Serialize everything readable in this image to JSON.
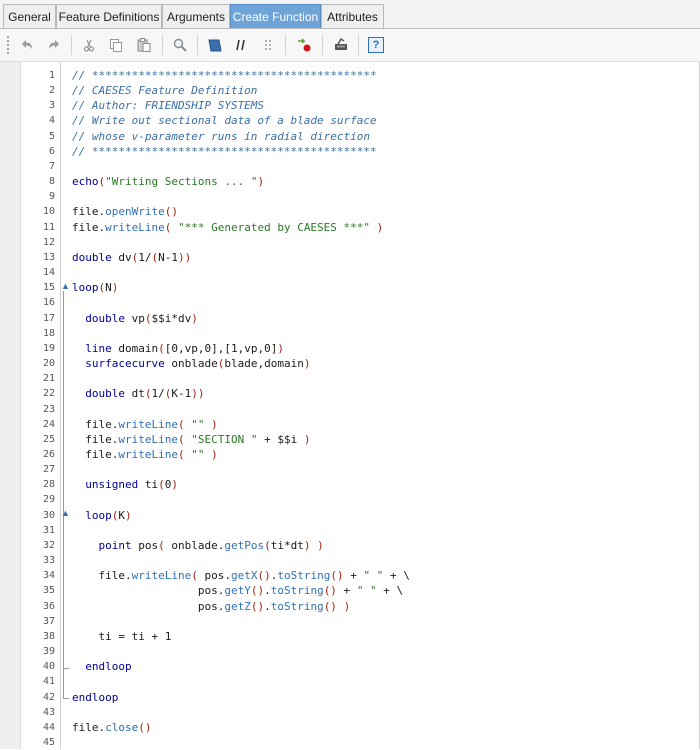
{
  "tabs": [
    {
      "label": "General",
      "active": false
    },
    {
      "label": "Feature Definitions",
      "active": false
    },
    {
      "label": "Arguments",
      "active": false
    },
    {
      "label": "Create Function",
      "active": true
    },
    {
      "label": "Attributes",
      "active": false
    }
  ],
  "toolbar": {
    "buttons": [
      {
        "name": "undo-icon"
      },
      {
        "name": "redo-icon"
      },
      {
        "name": "cut-icon"
      },
      {
        "name": "copy-icon"
      },
      {
        "name": "paste-icon"
      },
      {
        "name": "find-icon"
      },
      {
        "name": "bookmark-icon"
      },
      {
        "name": "comment-icon"
      },
      {
        "name": "grip-icon"
      },
      {
        "name": "insert-breakpoint-icon"
      },
      {
        "name": "execute-icon"
      },
      {
        "name": "help-icon"
      }
    ],
    "help_label": "?"
  },
  "colors": {
    "comment": "#3a6fa4",
    "keyword": "#000099",
    "method": "#2e6fb5",
    "string": "#2a7a24",
    "paren": "#a3230f",
    "active_tab": "#6ea4d8"
  },
  "editor": {
    "lines": [
      {
        "n": "1",
        "t": [
          [
            "c",
            "// *******************************************"
          ]
        ]
      },
      {
        "n": "2",
        "t": [
          [
            "c",
            "// CAESES Feature Definition"
          ]
        ]
      },
      {
        "n": "3",
        "t": [
          [
            "c",
            "// Author: FRIENDSHIP SYSTEMS"
          ]
        ]
      },
      {
        "n": "4",
        "t": [
          [
            "c",
            "// Write out sectional data of a blade surface"
          ]
        ]
      },
      {
        "n": "5",
        "t": [
          [
            "c",
            "// whose v-parameter runs in radial direction"
          ]
        ]
      },
      {
        "n": "6",
        "t": [
          [
            "c",
            "// *******************************************"
          ]
        ]
      },
      {
        "n": "7",
        "t": []
      },
      {
        "n": "8",
        "t": [
          [
            "k",
            "echo"
          ],
          [
            "p",
            "("
          ],
          [
            "s",
            "\"Writing Sections ... \""
          ],
          [
            "p",
            ")"
          ]
        ]
      },
      {
        "n": "9",
        "t": []
      },
      {
        "n": "10",
        "t": [
          [
            "t",
            "file."
          ],
          [
            "m",
            "openWrite"
          ],
          [
            "p",
            "()"
          ]
        ]
      },
      {
        "n": "11",
        "t": [
          [
            "t",
            "file."
          ],
          [
            "m",
            "writeLine"
          ],
          [
            "p",
            "("
          ],
          [
            "t",
            " "
          ],
          [
            "s",
            "\"*** Generated by CAESES ***\""
          ],
          [
            "t",
            " "
          ],
          [
            "p",
            ")"
          ]
        ]
      },
      {
        "n": "12",
        "t": []
      },
      {
        "n": "13",
        "t": [
          [
            "k",
            "double"
          ],
          [
            "t",
            " dv"
          ],
          [
            "p",
            "("
          ],
          [
            "t",
            "1/"
          ],
          [
            "p",
            "("
          ],
          [
            "t",
            "N-1"
          ],
          [
            "p",
            "))"
          ]
        ]
      },
      {
        "n": "14",
        "t": []
      },
      {
        "n": "15",
        "t": [
          [
            "k",
            "loop"
          ],
          [
            "p",
            "("
          ],
          [
            "t",
            "N"
          ],
          [
            "p",
            ")"
          ]
        ]
      },
      {
        "n": "16",
        "t": []
      },
      {
        "n": "17",
        "t": [
          [
            "t",
            "  "
          ],
          [
            "k",
            "double"
          ],
          [
            "t",
            " vp"
          ],
          [
            "p",
            "("
          ],
          [
            "t",
            "$$i*dv"
          ],
          [
            "p",
            ")"
          ]
        ]
      },
      {
        "n": "18",
        "t": []
      },
      {
        "n": "19",
        "t": [
          [
            "t",
            "  "
          ],
          [
            "k",
            "line"
          ],
          [
            "t",
            " domain"
          ],
          [
            "p",
            "("
          ],
          [
            "t",
            "[0,vp,0],[1,vp,0]"
          ],
          [
            "p",
            ")"
          ]
        ]
      },
      {
        "n": "20",
        "t": [
          [
            "t",
            "  "
          ],
          [
            "k",
            "surfacecurve"
          ],
          [
            "t",
            " onblade"
          ],
          [
            "p",
            "("
          ],
          [
            "t",
            "blade,domain"
          ],
          [
            "p",
            ")"
          ]
        ]
      },
      {
        "n": "21",
        "t": []
      },
      {
        "n": "22",
        "t": [
          [
            "t",
            "  "
          ],
          [
            "k",
            "double"
          ],
          [
            "t",
            " dt"
          ],
          [
            "p",
            "("
          ],
          [
            "t",
            "1/"
          ],
          [
            "p",
            "("
          ],
          [
            "t",
            "K-1"
          ],
          [
            "p",
            "))"
          ]
        ]
      },
      {
        "n": "23",
        "t": []
      },
      {
        "n": "24",
        "t": [
          [
            "t",
            "  file."
          ],
          [
            "m",
            "writeLine"
          ],
          [
            "p",
            "("
          ],
          [
            "t",
            " "
          ],
          [
            "s",
            "\"\""
          ],
          [
            "t",
            " "
          ],
          [
            "p",
            ")"
          ]
        ]
      },
      {
        "n": "25",
        "t": [
          [
            "t",
            "  file."
          ],
          [
            "m",
            "writeLine"
          ],
          [
            "p",
            "("
          ],
          [
            "t",
            " "
          ],
          [
            "s",
            "\"SECTION \""
          ],
          [
            "t",
            " + $$i "
          ],
          [
            "p",
            ")"
          ]
        ]
      },
      {
        "n": "26",
        "t": [
          [
            "t",
            "  file."
          ],
          [
            "m",
            "writeLine"
          ],
          [
            "p",
            "("
          ],
          [
            "t",
            " "
          ],
          [
            "s",
            "\"\""
          ],
          [
            "t",
            " "
          ],
          [
            "p",
            ")"
          ]
        ]
      },
      {
        "n": "27",
        "t": []
      },
      {
        "n": "28",
        "t": [
          [
            "t",
            "  "
          ],
          [
            "k",
            "unsigned"
          ],
          [
            "t",
            " ti"
          ],
          [
            "p",
            "("
          ],
          [
            "t",
            "0"
          ],
          [
            "p",
            ")"
          ]
        ]
      },
      {
        "n": "29",
        "t": []
      },
      {
        "n": "30",
        "t": [
          [
            "t",
            "  "
          ],
          [
            "k",
            "loop"
          ],
          [
            "p",
            "("
          ],
          [
            "t",
            "K"
          ],
          [
            "p",
            ")"
          ]
        ]
      },
      {
        "n": "31",
        "t": []
      },
      {
        "n": "32",
        "t": [
          [
            "t",
            "    "
          ],
          [
            "k",
            "point"
          ],
          [
            "t",
            " pos"
          ],
          [
            "p",
            "("
          ],
          [
            "t",
            " onblade."
          ],
          [
            "m",
            "getPos"
          ],
          [
            "p",
            "("
          ],
          [
            "t",
            "ti*dt"
          ],
          [
            "p",
            ")"
          ],
          [
            "t",
            " "
          ],
          [
            "p",
            ")"
          ]
        ]
      },
      {
        "n": "33",
        "t": []
      },
      {
        "n": "34",
        "t": [
          [
            "t",
            "    file."
          ],
          [
            "m",
            "writeLine"
          ],
          [
            "p",
            "("
          ],
          [
            "t",
            " pos."
          ],
          [
            "m",
            "getX"
          ],
          [
            "p",
            "()"
          ],
          [
            "t",
            "."
          ],
          [
            "m",
            "toString"
          ],
          [
            "p",
            "()"
          ],
          [
            "t",
            " + "
          ],
          [
            "s",
            "\" \""
          ],
          [
            "t",
            " + \\"
          ]
        ]
      },
      {
        "n": "35",
        "t": [
          [
            "t",
            "                   pos."
          ],
          [
            "m",
            "getY"
          ],
          [
            "p",
            "()"
          ],
          [
            "t",
            "."
          ],
          [
            "m",
            "toString"
          ],
          [
            "p",
            "()"
          ],
          [
            "t",
            " + "
          ],
          [
            "s",
            "\" \""
          ],
          [
            "t",
            " + \\"
          ]
        ]
      },
      {
        "n": "36",
        "t": [
          [
            "t",
            "                   pos."
          ],
          [
            "m",
            "getZ"
          ],
          [
            "p",
            "()"
          ],
          [
            "t",
            "."
          ],
          [
            "m",
            "toString"
          ],
          [
            "p",
            "()"
          ],
          [
            "t",
            " "
          ],
          [
            "p",
            ")"
          ]
        ]
      },
      {
        "n": "37",
        "t": []
      },
      {
        "n": "38",
        "t": [
          [
            "t",
            "    ti = ti + 1"
          ]
        ]
      },
      {
        "n": "39",
        "t": []
      },
      {
        "n": "40",
        "t": [
          [
            "t",
            "  "
          ],
          [
            "k",
            "endloop"
          ]
        ]
      },
      {
        "n": "41",
        "t": []
      },
      {
        "n": "42",
        "t": [
          [
            "k",
            "endloop"
          ]
        ]
      },
      {
        "n": "43",
        "t": []
      },
      {
        "n": "44",
        "t": [
          [
            "t",
            "file."
          ],
          [
            "m",
            "close"
          ],
          [
            "p",
            "()"
          ]
        ]
      },
      {
        "n": "45",
        "t": []
      }
    ]
  }
}
